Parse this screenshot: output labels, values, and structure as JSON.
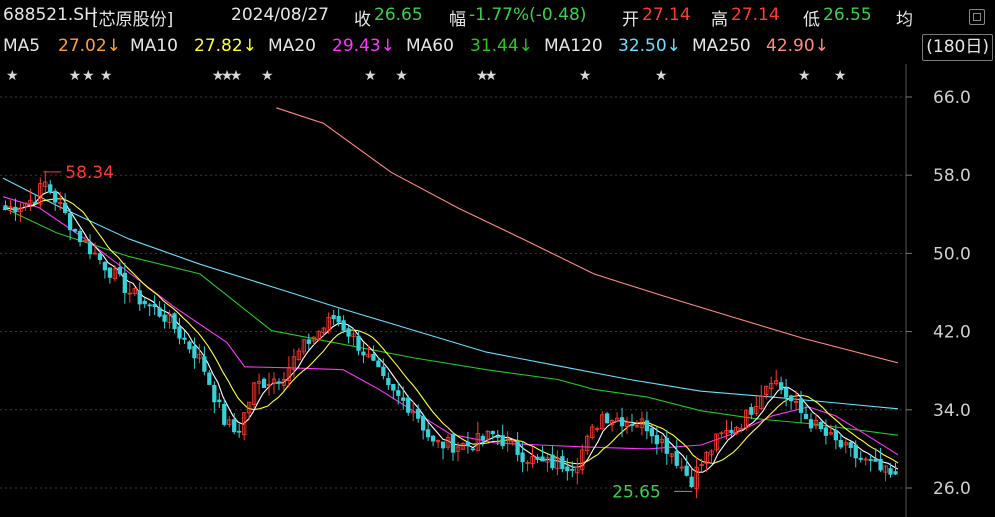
{
  "header": {
    "code": "688521.SH",
    "name": "[芯原股份]",
    "date": "2024/08/27",
    "close_label": "收",
    "close": "26.65",
    "change_label": "幅",
    "change": "-1.77%(-0.48)",
    "open_label": "开",
    "open": "27.14",
    "high_label": "高",
    "high": "27.14",
    "low_label": "低",
    "low": "26.55",
    "avg_label": "均"
  },
  "ma_bar": {
    "items": [
      {
        "label": "MA5",
        "value": "27.02↓"
      },
      {
        "label": "MA10",
        "value": "27.82↓"
      },
      {
        "label": "MA20",
        "value": "29.43↓"
      },
      {
        "label": "MA60",
        "value": "31.44↓"
      },
      {
        "label": "MA120",
        "value": "32.50↓"
      },
      {
        "label": "MA250",
        "value": "42.90↓"
      }
    ],
    "range_label": "(180日)"
  },
  "colors": {
    "up": "#ff3b30",
    "down": "#39d0d8",
    "ma5": "#ffffff",
    "ma10": "#ffff33",
    "ma20": "#ff33ff",
    "ma60": "#22c722",
    "ma120": "#66e0ff",
    "ma250": "#ff8a80",
    "grid": "#3a3a3a"
  },
  "chart_data": {
    "type": "candlestick",
    "y_ticks": [
      "66.0",
      "58.0",
      "50.0",
      "42.0",
      "34.0",
      "26.0"
    ],
    "ylim": [
      26.0,
      66.0
    ],
    "annotations": {
      "high_value": "58.34",
      "low_value": "25.65"
    },
    "marker_glyph": "★",
    "ma250": [
      [
        0.0,
        66.2
      ],
      [
        0.08,
        64.9
      ],
      [
        0.15,
        63.3
      ],
      [
        0.25,
        58.3
      ],
      [
        0.35,
        54.6
      ],
      [
        0.45,
        51.3
      ],
      [
        0.55,
        47.9
      ],
      [
        0.65,
        45.7
      ],
      [
        0.75,
        43.6
      ],
      [
        0.86,
        41.3
      ],
      [
        1.0,
        38.8
      ]
    ],
    "ma120": [
      [
        0.0,
        57.7
      ],
      [
        0.06,
        54.9
      ],
      [
        0.14,
        51.5
      ],
      [
        0.22,
        48.9
      ],
      [
        0.3,
        46.6
      ],
      [
        0.38,
        44.3
      ],
      [
        0.46,
        42.1
      ],
      [
        0.54,
        39.9
      ],
      [
        0.62,
        38.5
      ],
      [
        0.7,
        37.1
      ],
      [
        0.78,
        35.9
      ],
      [
        0.86,
        35.3
      ],
      [
        0.92,
        34.8
      ],
      [
        1.0,
        34.1
      ]
    ],
    "ma60": [
      [
        0.0,
        54.7
      ],
      [
        0.06,
        52.1
      ],
      [
        0.14,
        49.7
      ],
      [
        0.22,
        47.9
      ],
      [
        0.3,
        42.1
      ],
      [
        0.38,
        40.7
      ],
      [
        0.46,
        39.3
      ],
      [
        0.54,
        38.1
      ],
      [
        0.62,
        37.1
      ],
      [
        0.66,
        36.1
      ],
      [
        0.72,
        35.3
      ],
      [
        0.78,
        33.9
      ],
      [
        0.84,
        33.1
      ],
      [
        0.9,
        32.6
      ],
      [
        1.0,
        31.4
      ]
    ],
    "ma20": [
      [
        0.0,
        55.8
      ],
      [
        0.04,
        54.7
      ],
      [
        0.09,
        51.6
      ],
      [
        0.14,
        48.1
      ],
      [
        0.19,
        44.6
      ],
      [
        0.25,
        40.9
      ],
      [
        0.27,
        38.4
      ],
      [
        0.32,
        38.3
      ],
      [
        0.38,
        38.1
      ],
      [
        0.42,
        36.1
      ],
      [
        0.46,
        33.8
      ],
      [
        0.5,
        31.5
      ],
      [
        0.55,
        30.6
      ],
      [
        0.6,
        30.4
      ],
      [
        0.65,
        30.2
      ],
      [
        0.72,
        30.0
      ],
      [
        0.78,
        30.4
      ],
      [
        0.82,
        31.7
      ],
      [
        0.86,
        33.4
      ],
      [
        0.9,
        34.3
      ],
      [
        0.93,
        33.4
      ],
      [
        0.96,
        31.7
      ],
      [
        1.0,
        29.4
      ]
    ]
  }
}
